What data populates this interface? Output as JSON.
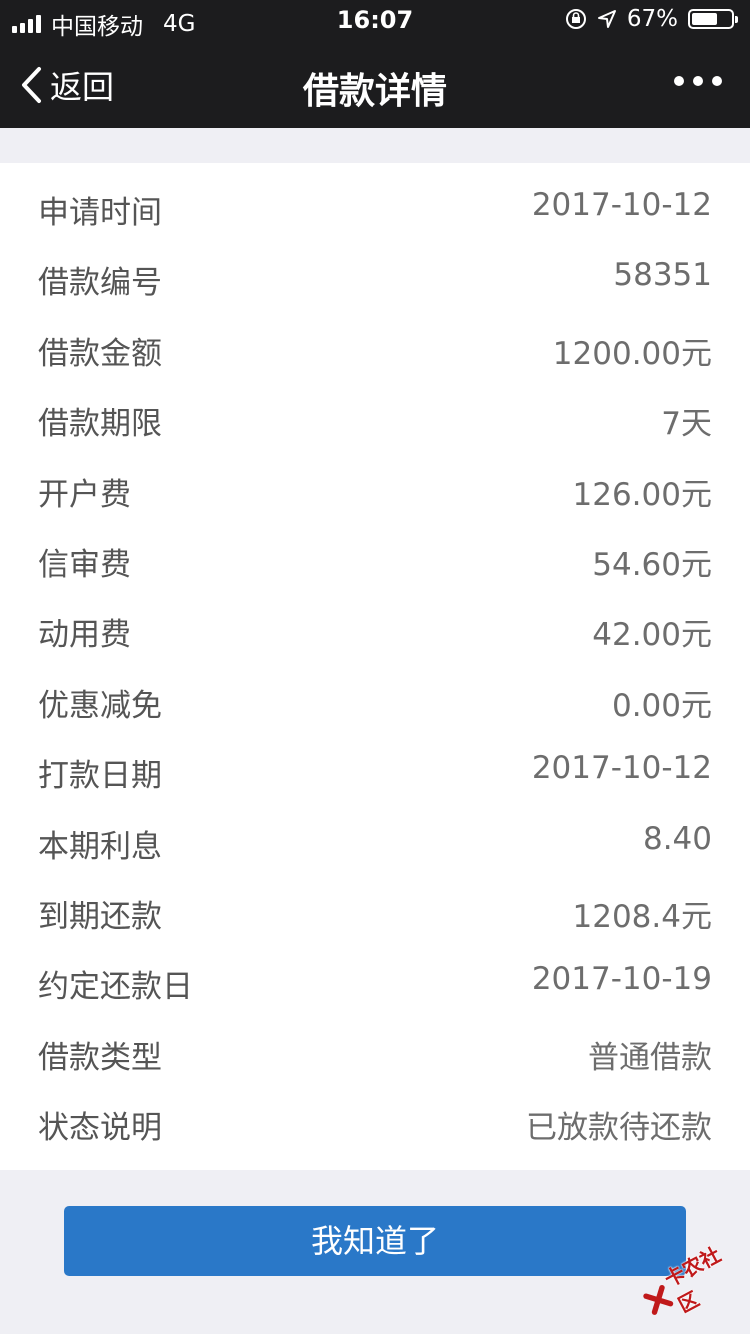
{
  "status_bar": {
    "carrier": "中国移动",
    "network": "4G",
    "time": "16:07",
    "battery": "67%",
    "battery_level": 0.67
  },
  "navbar": {
    "back_label": "返回",
    "title": "借款详情"
  },
  "details": [
    {
      "label": "申请时间",
      "value": "2017-10-12"
    },
    {
      "label": "借款编号",
      "value": "58351"
    },
    {
      "label": "借款金额",
      "value": "1200.00元"
    },
    {
      "label": "借款期限",
      "value": "7天"
    },
    {
      "label": "开户费",
      "value": "126.00元"
    },
    {
      "label": "信审费",
      "value": "54.60元"
    },
    {
      "label": "动用费",
      "value": "42.00元"
    },
    {
      "label": "优惠减免",
      "value": "0.00元"
    },
    {
      "label": "打款日期",
      "value": "2017-10-12"
    },
    {
      "label": "本期利息",
      "value": "8.40"
    },
    {
      "label": "到期还款",
      "value": "1208.4元"
    },
    {
      "label": "约定还款日",
      "value": "2017-10-19"
    },
    {
      "label": "借款类型",
      "value": "普通借款"
    },
    {
      "label": "状态说明",
      "value": "已放款待还款"
    }
  ],
  "confirm_button": "我知道了",
  "watermark": "卡农社区",
  "colors": {
    "topbar": "#1c1c1e",
    "accent": "#2a78c8",
    "background": "#efeff4"
  }
}
